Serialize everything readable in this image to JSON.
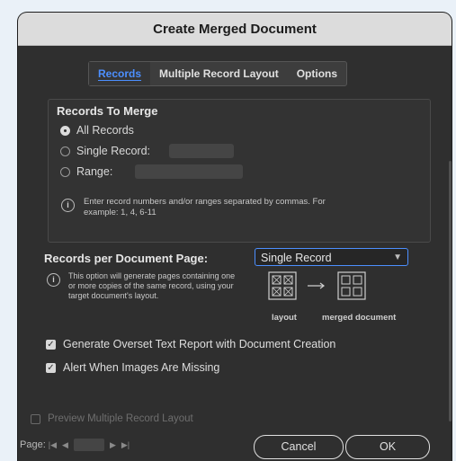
{
  "dialog": {
    "title": "Create Merged Document"
  },
  "tabs": [
    {
      "label": "Records",
      "active": true
    },
    {
      "label": "Multiple Record Layout",
      "active": false
    },
    {
      "label": "Options",
      "active": false
    }
  ],
  "records_to_merge": {
    "title": "Records To Merge",
    "options": [
      {
        "label": "All Records",
        "checked": true
      },
      {
        "label": "Single Record:",
        "checked": false
      },
      {
        "label": "Range:",
        "checked": false
      }
    ],
    "info": "Enter record numbers and/or ranges separated by commas. For example: 1, 4, 6-11"
  },
  "records_per_page": {
    "label": "Records per Document Page:",
    "selected": "Single Record",
    "info": "This option will generate pages containing one or more copies of the same record, using your target document's layout.",
    "diagram_labels": {
      "layout": "layout",
      "merged": "merged document"
    }
  },
  "checkboxes": [
    {
      "label": "Generate Overset Text Report with Document Creation",
      "checked": true
    },
    {
      "label": "Alert When Images Are Missing",
      "checked": true
    }
  ],
  "preview": {
    "label": "Preview Multiple Record Layout",
    "checked": false,
    "enabled": false
  },
  "pager": {
    "label": "Page:"
  },
  "buttons": {
    "cancel": "Cancel",
    "ok": "OK"
  },
  "colors": {
    "accent": "#4c8fff",
    "background": "#2f2f2f"
  },
  "icons": [
    "info-icon",
    "chevron-down-icon",
    "first-page-icon",
    "prev-page-icon",
    "next-page-icon",
    "last-page-icon"
  ]
}
